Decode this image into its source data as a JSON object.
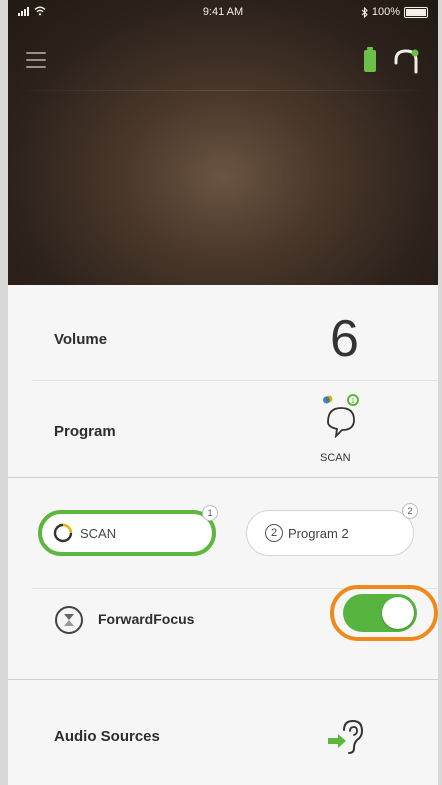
{
  "status_bar": {
    "time": "9:41 AM",
    "battery_text": "100%"
  },
  "header": {
    "menu_icon": "hamburger-menu-icon",
    "battery_icon": "hearing-aid-battery-icon",
    "device_icon": "hearing-aid-device-icon"
  },
  "volume": {
    "label": "Volume",
    "value": "6"
  },
  "program": {
    "label": "Program",
    "icon": "scan-program-icon",
    "value": "SCAN"
  },
  "programs": [
    {
      "label": "SCAN",
      "badge": "1",
      "selected": true,
      "icon": "scan-loading-icon"
    },
    {
      "label": "Program 2",
      "badge": "2",
      "selected": false,
      "prefix": "2"
    }
  ],
  "forward_focus": {
    "label": "ForwardFocus",
    "icon": "forward-focus-icon",
    "enabled": true
  },
  "audio_sources": {
    "label": "Audio Sources",
    "icon": "ear-audio-icon"
  },
  "colors": {
    "accent_green": "#57b53f",
    "highlight_orange": "#ef8a1a",
    "header_brown": "#2e231c"
  }
}
